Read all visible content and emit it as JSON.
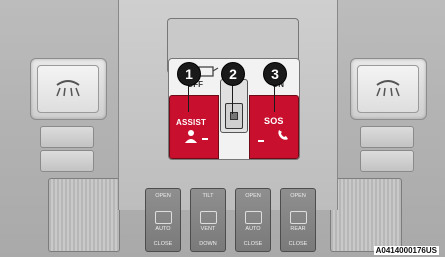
{
  "callouts": [
    "1",
    "2",
    "3"
  ],
  "buttons": {
    "assist": {
      "label": "ASSIST"
    },
    "sos": {
      "label": "SOS"
    },
    "center_switch": {
      "icon": "rocker-switch-icon"
    }
  },
  "lens": {
    "left_text": "OFF",
    "right_text": "ON"
  },
  "bottom_switches": [
    {
      "top": "OPEN",
      "middle": "AUTO",
      "bottom": "CLOSE"
    },
    {
      "top": "TILT",
      "middle": "VENT",
      "bottom": "DOWN"
    },
    {
      "top": "OPEN",
      "middle": "AUTO",
      "bottom": "CLOSE"
    },
    {
      "top": "OPEN",
      "middle": "REAR",
      "bottom": "CLOSE"
    }
  ],
  "figure_code": "A0414000176US",
  "colors": {
    "red_button": "#c8102e",
    "callout": "#1a1a1a"
  }
}
